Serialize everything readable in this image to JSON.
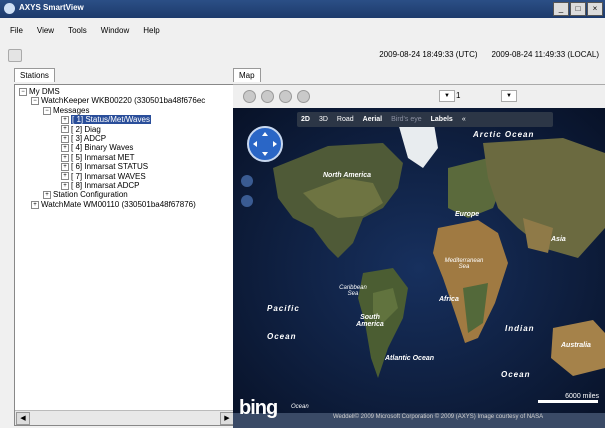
{
  "window": {
    "title": "AXYS SmartView",
    "buttons": [
      "_",
      "□",
      "×"
    ]
  },
  "menu": [
    "File",
    "View",
    "Tools",
    "Window",
    "Help"
  ],
  "toolbar": {
    "utc_time": "2009-08-24 18:49:33  (UTC)",
    "local_time": "2009-08-24 11:49:33  (LOCAL)"
  },
  "left_tab": "Stations",
  "tree": {
    "root": "My DMS",
    "station1": "WatchKeeper WKB00220 (330501ba48f676ec",
    "messages": "Messages",
    "items": [
      "[ 1] Status/Met/Waves",
      "[ 2] Diag",
      "[ 3] ADCP",
      "[ 4] Binary Waves",
      "[ 5] Inmarsat MET",
      "[ 6] Inmarsat STATUS",
      "[ 7] Inmarsat WAVES",
      "[ 8] Inmarsat ADCP"
    ],
    "station_config": "Station Configuration",
    "station2": "WatchMate WM00110 (330501ba48f67876)"
  },
  "map_tab": "Map",
  "map_bar": {
    "selected_value": "1"
  },
  "map_tools": [
    "2D",
    "3D",
    "Road",
    "Aerial",
    "Bird's eye",
    "Labels",
    "«"
  ],
  "map_labels": {
    "arctic_ocean": "Arctic Ocean",
    "north_america": "North America",
    "europe": "Europe",
    "asia": "Asia",
    "mediterranean_sea": "Mediterranean Sea",
    "caribbean_sea": "Caribbean Sea",
    "africa": "Africa",
    "south_america": "South America",
    "pacific": "Pacific",
    "ocean": "Ocean",
    "atlantic_ocean": "Atlantic Ocean",
    "indian": "Indian",
    "ocean2": "Ocean",
    "australia": "Australia",
    "bing_ocean": "Ocean"
  },
  "map_footer": {
    "brand": "bing",
    "scale": "6000 miles",
    "credits": "Weddell© 2009 Microsoft Corporation  © 2009 (AXYS)  Image courtesy of NASA"
  }
}
